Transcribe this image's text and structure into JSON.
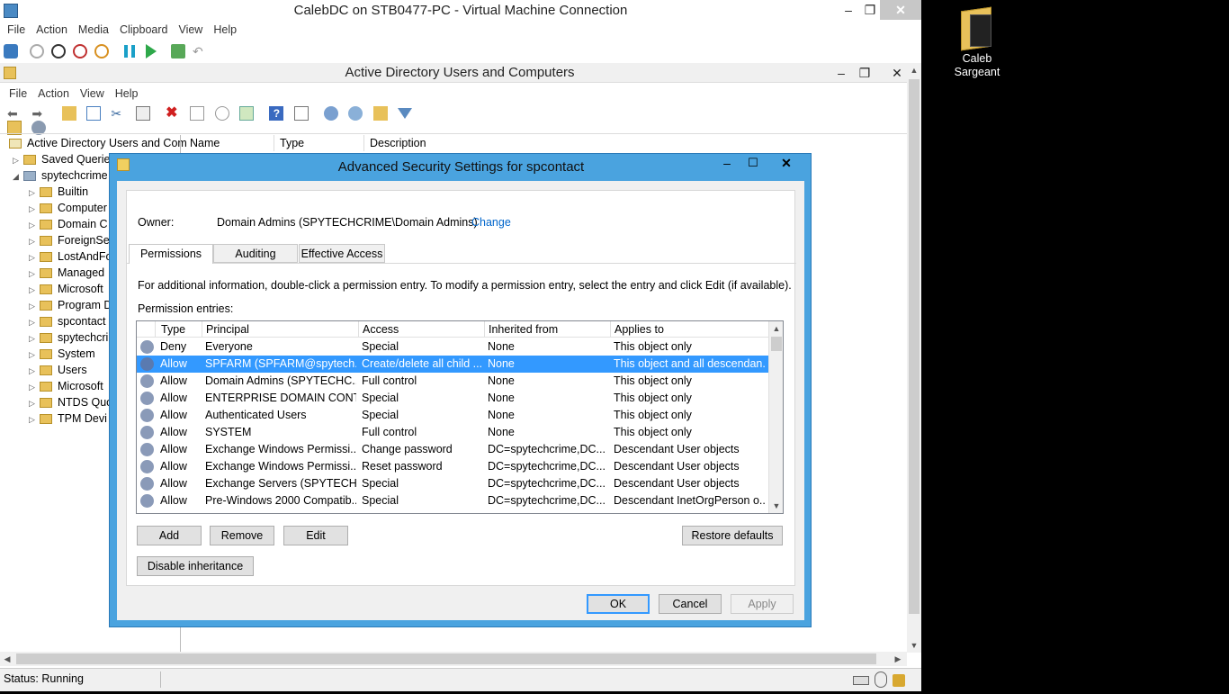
{
  "vm": {
    "title": "CalebDC on STB0477-PC - Virtual Machine Connection",
    "menu": [
      "File",
      "Action",
      "Media",
      "Clipboard",
      "View",
      "Help"
    ],
    "status": "Status: Running"
  },
  "aduc": {
    "title": "Active Directory Users and Computers",
    "menu": [
      "File",
      "Action",
      "View",
      "Help"
    ],
    "tree": {
      "root": "Active Directory Users and Com",
      "saved": "Saved Queries",
      "domain": "spytechcrime",
      "items": [
        "Builtin",
        "Computer",
        "Domain C",
        "ForeignSe",
        "LostAndFo",
        "Managed",
        "Microsoft",
        "Program D",
        "spcontact",
        "spytechcri",
        "System",
        "Users",
        "Microsoft",
        "NTDS Quo",
        "TPM Devi"
      ]
    },
    "columns": [
      "Name",
      "Type",
      "Description"
    ]
  },
  "dialog": {
    "title": "Advanced Security Settings for spcontact",
    "owner_label": "Owner:",
    "owner_value": "Domain Admins (SPYTECHCRIME\\Domain Admins)",
    "change_link": "Change",
    "tabs": [
      "Permissions",
      "Auditing",
      "Effective Access"
    ],
    "info": "For additional information, double-click a permission entry. To modify a permission entry, select the entry and click Edit (if available).",
    "entries_label": "Permission entries:",
    "columns": [
      "Type",
      "Principal",
      "Access",
      "Inherited from",
      "Applies to"
    ],
    "rows": [
      [
        "Deny",
        "Everyone",
        "Special",
        "None",
        "This object only"
      ],
      [
        "Allow",
        "SPFARM (SPFARM@spytech...",
        "Create/delete all child ...",
        "None",
        "This object and all descendan..."
      ],
      [
        "Allow",
        "Domain Admins (SPYTECHC...",
        "Full control",
        "None",
        "This object only"
      ],
      [
        "Allow",
        "ENTERPRISE DOMAIN CONT...",
        "Special",
        "None",
        "This object only"
      ],
      [
        "Allow",
        "Authenticated Users",
        "Special",
        "None",
        "This object only"
      ],
      [
        "Allow",
        "SYSTEM",
        "Full control",
        "None",
        "This object only"
      ],
      [
        "Allow",
        "Exchange Windows Permissi...",
        "Change password",
        "DC=spytechcrime,DC...",
        "Descendant User objects"
      ],
      [
        "Allow",
        "Exchange Windows Permissi...",
        "Reset password",
        "DC=spytechcrime,DC...",
        "Descendant User objects"
      ],
      [
        "Allow",
        "Exchange Servers (SPYTECH...",
        "Special",
        "DC=spytechcrime,DC...",
        "Descendant User objects"
      ],
      [
        "Allow",
        "Pre-Windows 2000 Compatib...",
        "Special",
        "DC=spytechcrime,DC...",
        "Descendant InetOrgPerson o..."
      ]
    ],
    "selected_row": 1,
    "buttons": {
      "add": "Add",
      "remove": "Remove",
      "edit": "Edit",
      "restore": "Restore defaults",
      "disable": "Disable inheritance",
      "ok": "OK",
      "cancel": "Cancel",
      "apply": "Apply"
    }
  },
  "desktop": {
    "folder_label_1": "Caleb",
    "folder_label_2": "Sargeant"
  },
  "colors": {
    "dialog_frame": "#4aa3df",
    "selection": "#3399ff",
    "link": "#0066cc"
  }
}
